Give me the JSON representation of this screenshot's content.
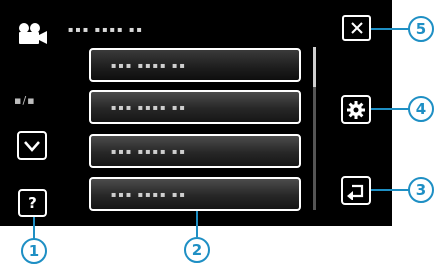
{
  "header": {
    "title_text": "▪▪▪ ▪▪▪▪ ▪▪",
    "mode_icon": "movie-camera-icon",
    "close_icon": "close-icon"
  },
  "menu": {
    "items": [
      {
        "label": "▪▪▪ ▪▪▪▪ ▪▪"
      },
      {
        "label": "▪▪▪ ▪▪▪▪ ▪▪"
      },
      {
        "label": "▪▪▪ ▪▪▪▪ ▪▪"
      },
      {
        "label": "▪▪▪ ▪▪▪▪ ▪▪"
      }
    ],
    "scroll_position": 0.0
  },
  "left_panel": {
    "page_indicator": "▪/▪",
    "down_icon": "chevron-down-icon",
    "help_label": "?"
  },
  "right_panel": {
    "settings_icon": "gear-icon",
    "back_icon": "return-arrow-icon"
  },
  "callouts": [
    "1",
    "2",
    "3",
    "4",
    "5"
  ],
  "colors": {
    "screen_bg": "#000000",
    "button_border": "#ffffff",
    "callout": "#1e8fc4"
  }
}
